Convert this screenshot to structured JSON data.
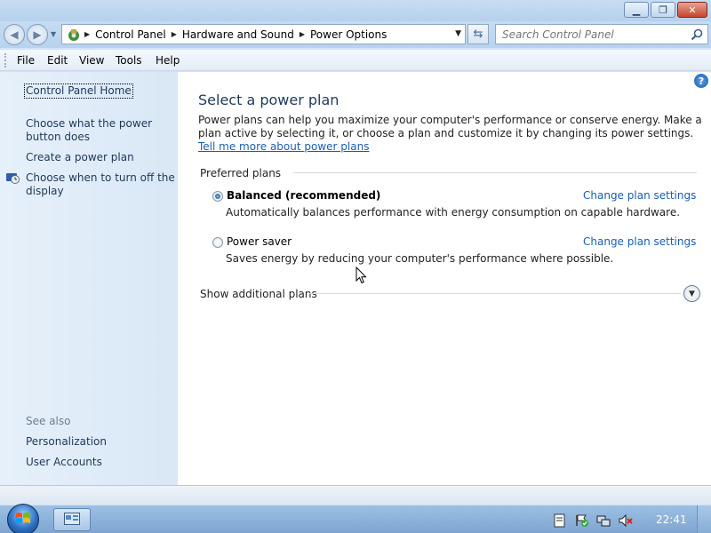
{
  "titlebar": {
    "minimize_icon": "minimize-icon",
    "maximize_icon": "maximize-icon",
    "close_icon": "close-icon"
  },
  "address": {
    "breadcrumbs": [
      "Control Panel",
      "Hardware and Sound",
      "Power Options"
    ],
    "search_placeholder": "Search Control Panel"
  },
  "menu": {
    "items": [
      "File",
      "Edit",
      "View",
      "Tools",
      "Help"
    ]
  },
  "leftnav": {
    "home": "Control Panel Home",
    "links": [
      "Choose what the power button does",
      "Create a power plan",
      "Choose when to turn off the display"
    ],
    "see_also": "See also",
    "see_also_links": [
      "Personalization",
      "User Accounts"
    ]
  },
  "main": {
    "title": "Select a power plan",
    "intro": "Power plans can help you maximize your computer's performance or conserve energy. Make a plan active by selecting it, or choose a plan and customize it by changing its power settings. ",
    "intro_link": "Tell me more about power plans",
    "preferred_heading": "Preferred plans",
    "plans": [
      {
        "name": "Balanced (recommended)",
        "description": "Automatically balances performance with energy consumption on capable hardware.",
        "change_link": "Change plan settings",
        "selected": true
      },
      {
        "name": "Power saver",
        "description": "Saves energy by reducing your computer's performance where possible.",
        "change_link": "Change plan settings",
        "selected": false
      }
    ],
    "additional_heading": "Show additional plans"
  },
  "taskbar": {
    "clock": "22:41"
  },
  "colors": {
    "link": "#1a5eb5",
    "nav_text": "#1e3958",
    "leftnav_bg": "#dfeaf7"
  }
}
